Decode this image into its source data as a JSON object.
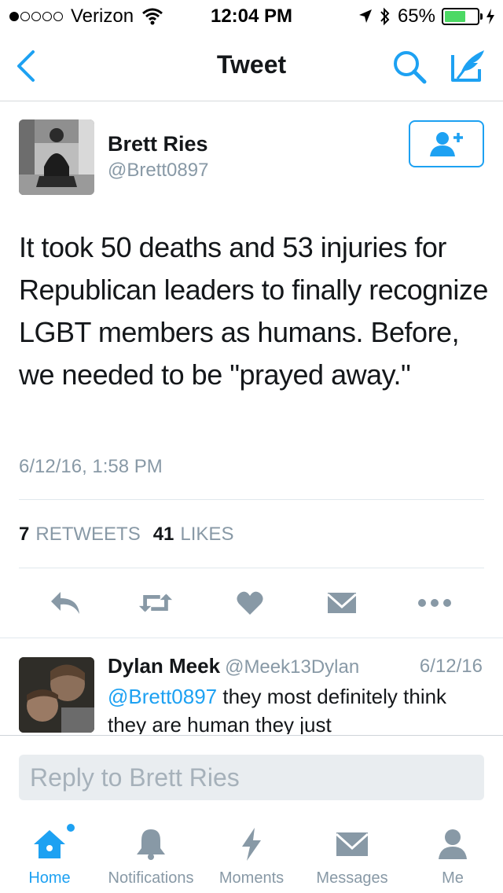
{
  "status_bar": {
    "carrier": "Verizon",
    "time": "12:04 PM",
    "battery": "65%",
    "battery_level": 0.65,
    "signal_bars": 1,
    "icons": [
      "wifi-icon",
      "location-icon",
      "bluetooth-icon",
      "battery-icon",
      "charging-icon"
    ]
  },
  "nav": {
    "title": "Tweet",
    "icons": [
      "back-chevron-icon",
      "search-icon",
      "compose-icon"
    ],
    "accent": "#1da1f2"
  },
  "tweet": {
    "author_name": "Brett Ries",
    "author_handle": "@Brett0897",
    "text": "It took 50 deaths and 53 injuries for Republican leaders to finally recognize LGBT members as humans. Before, we needed to be \"prayed away.\"",
    "timestamp": "6/12/16, 1:58 PM",
    "retweets_count": "7",
    "retweets_label": "RETWEETS",
    "likes_count": "41",
    "likes_label": "LIKES",
    "follow_icon": "add-user-icon",
    "action_icons": [
      "reply-icon",
      "retweet-icon",
      "heart-icon",
      "message-icon",
      "more-icon"
    ]
  },
  "reply": {
    "author_name": "Dylan Meek",
    "author_handle": "@Meek13Dylan",
    "date": "6/12/16",
    "mention": "@Brett0897",
    "text": " they most definitely think they are human they just"
  },
  "composer": {
    "placeholder": "Reply to Brett Ries"
  },
  "tabbar": {
    "tabs": [
      {
        "label": "Home",
        "icon": "home-icon",
        "active": true
      },
      {
        "label": "Notifications",
        "icon": "bell-icon",
        "active": false
      },
      {
        "label": "Moments",
        "icon": "lightning-icon",
        "active": false
      },
      {
        "label": "Messages",
        "icon": "envelope-icon",
        "active": false
      },
      {
        "label": "Me",
        "icon": "person-icon",
        "active": false
      }
    ],
    "active_color": "#1da1f2",
    "inactive_color": "#8899a6"
  }
}
